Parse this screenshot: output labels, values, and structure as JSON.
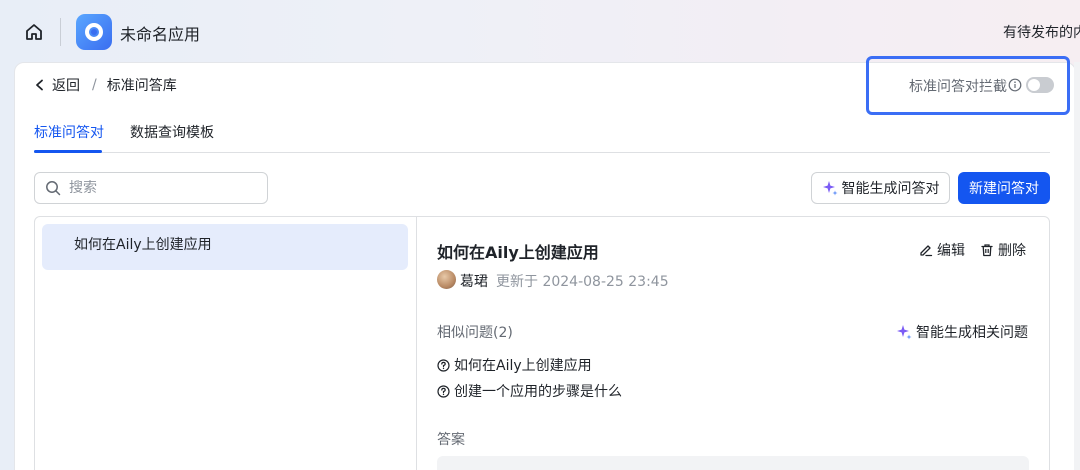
{
  "topbar": {
    "app_name": "未命名应用",
    "right_text": "有待发布的内"
  },
  "breadcrumb": {
    "back_label": "返回",
    "separator": "/",
    "current": "标准问答库"
  },
  "intercept": {
    "label": "标准问答对拦截",
    "enabled": false
  },
  "tabs": [
    {
      "label": "标准问答对",
      "active": true
    },
    {
      "label": "数据查询模板",
      "active": false
    }
  ],
  "search": {
    "placeholder": "搜索"
  },
  "actions": {
    "ai_generate_label": "智能生成问答对",
    "new_label": "新建问答对"
  },
  "list": {
    "items": [
      {
        "label": "如何在Aily上创建应用",
        "selected": true
      }
    ]
  },
  "detail": {
    "title": "如何在Aily上创建应用",
    "edit_label": "编辑",
    "delete_label": "删除",
    "author": "葛珺",
    "updated": "更新于 2024-08-25 23:45",
    "similar_label": "相似问题(2)",
    "ai_related_label": "智能生成相关问题",
    "similar_questions": [
      "如何在Aily上创建应用",
      "创建一个应用的步骤是什么"
    ],
    "answer_label": "答案"
  },
  "colors": {
    "accent": "#1456f0",
    "highlight_border": "#3b6ef5",
    "selected_bg": "#e5ecfc",
    "sparkle": "#7b5cf5"
  }
}
